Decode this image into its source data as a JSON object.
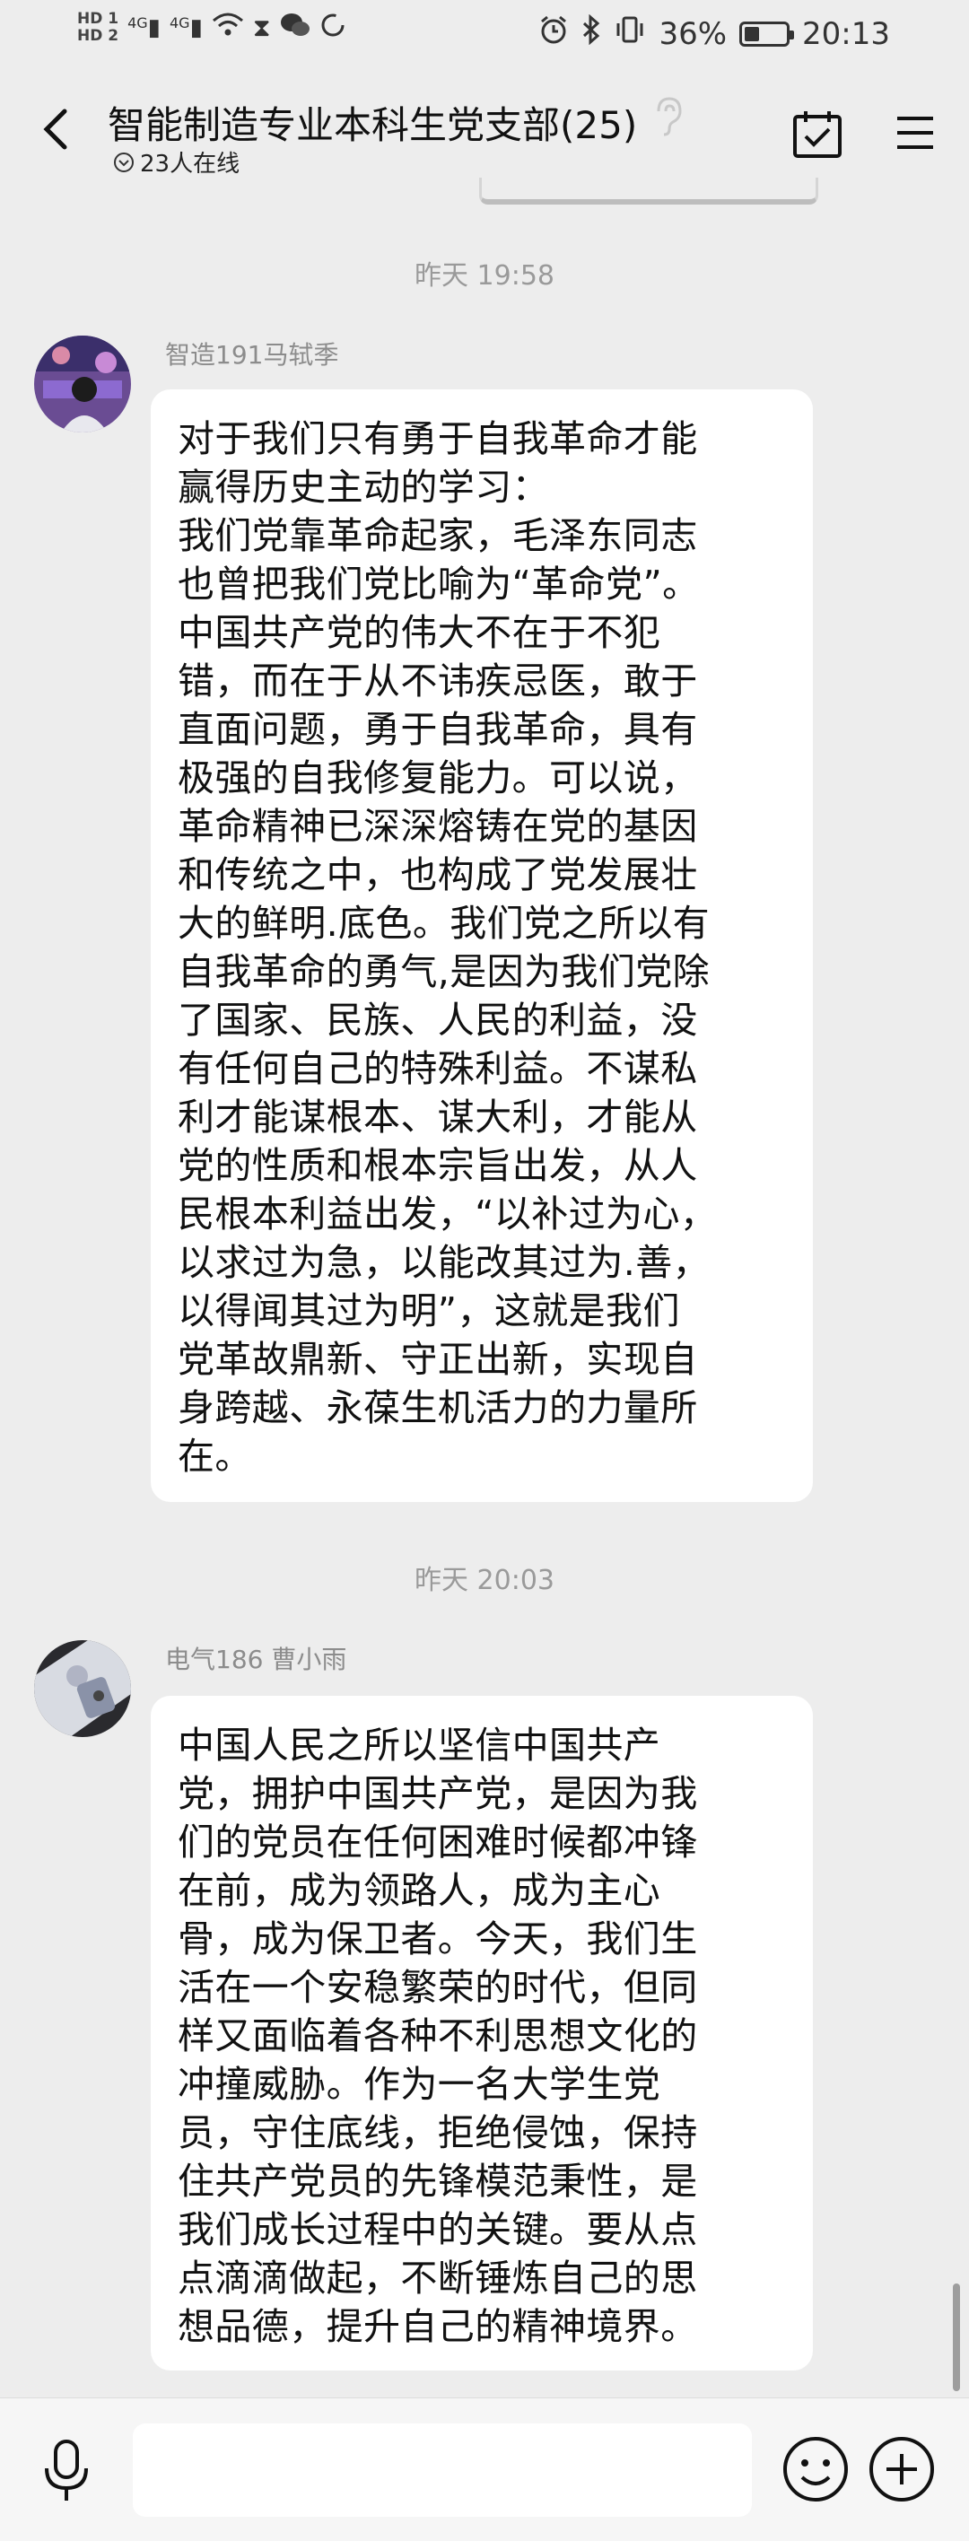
{
  "status_bar": {
    "hd1": "HD 1",
    "hd2": "HD 2",
    "sig1": "4G",
    "sig2": "4G",
    "battery_percent": "36%",
    "battery_level": 0.36,
    "time": "20:13"
  },
  "header": {
    "title": "智能制造专业本科生党支部(25)",
    "online": "23人在线"
  },
  "messages": [
    {
      "timestamp": "昨天 19:58",
      "sender": "智造191马轼季",
      "text": "对于我们只有勇于自我革命才能\n赢得历史主动的学习：\n我们党靠革命起家，毛泽东同志\n也曾把我们党比喻为“革命党”。\n中国共产党的伟大不在于不犯\n错，而在于从不讳疾忌医，敢于\n直面问题，勇于自我革命，具有\n极强的自我修复能力。可以说，\n革命精神已深深熔铸在党的基因\n和传统之中，也构成了党发展壮\n大的鲜明.底色。我们党之所以有\n自我革命的勇气,是因为我们党除\n了国家、民族、人民的利益，没\n有任何自己的特殊利益。不谋私\n利才能谋根本、谋大利，才能从\n党的性质和根本宗旨出发，从人\n民根本利益出发，“以补过为心，\n以求过为急，以能改其过为.善，\n以得闻其过为明”，这就是我们\n党革故鼎新、守正出新，实现自\n身跨越、永葆生机活力的力量所\n在。"
    },
    {
      "timestamp": "昨天 20:03",
      "sender": "电气186 曹小雨",
      "text": "中国人民之所以坚信中国共产\n党，拥护中国共产党，是因为我\n们的党员在任何困难时候都冲锋\n在前，成为领路人，成为主心\n骨，成为保卫者。今天，我们生\n活在一个安稳繁荣的时代，但同\n样又面临着各种不利思想文化的\n冲撞威胁。作为一名大学生党\n员，守住底线，拒绝侵蚀，保持\n住共产党员的先锋模范秉性，是\n我们成长过程中的关键。要从点\n点滴滴做起，不断锤炼自己的思\n想品德，提升自己的精神境界。"
    }
  ],
  "input": {
    "value": ""
  },
  "icons": [
    "back-icon",
    "hearing-icon",
    "calendar-check-icon",
    "menu-icon",
    "microphone-icon",
    "emoji-icon",
    "plus-icon"
  ]
}
